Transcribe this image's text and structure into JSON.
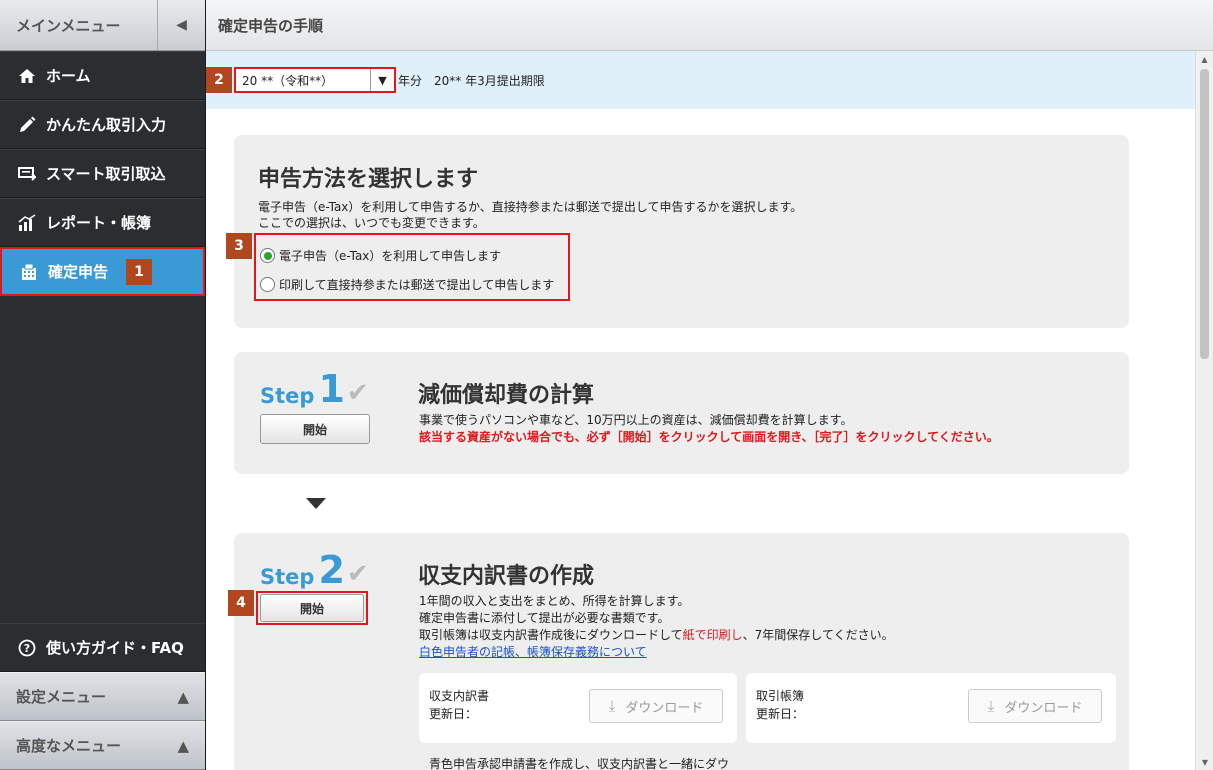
{
  "sidebar": {
    "title": "メインメニュー",
    "items": [
      {
        "label": "ホーム",
        "icon": "home-icon"
      },
      {
        "label": "かんたん取引入力",
        "icon": "pencil-icon"
      },
      {
        "label": "スマート取引取込",
        "icon": "import-icon"
      },
      {
        "label": "レポート・帳簿",
        "icon": "report-chart-icon"
      },
      {
        "label": "確定申告",
        "icon": "tax-return-icon",
        "active": true,
        "badge": "1"
      }
    ],
    "guide": "使い方ガイド・FAQ",
    "settings_menu": "設定メニュー",
    "advanced_menu": "高度なメニュー"
  },
  "header": {
    "title": "確定申告の手順"
  },
  "year_bar": {
    "badge": "2",
    "selected": "20 **（令和**）",
    "suffix": "年分",
    "deadline": "20** 年3月提出期限"
  },
  "method": {
    "title": "申告方法を選択します",
    "desc1": "電子申告（e-Tax）を利用して申告するか、直接持参または郵送で提出して申告するかを選択します。",
    "desc2": "ここでの選択は、いつでも変更できます。",
    "badge": "3",
    "option1": "電子申告（e-Tax）を利用して申告します",
    "option2": "印刷して直接持参または郵送で提出して申告します"
  },
  "step1": {
    "word": "Step",
    "num": "1",
    "button": "開始",
    "title": "減価償却費の計算",
    "desc": "事業で使うパソコンや車など、10万円以上の資産は、減価償却費を計算します。",
    "warning": "該当する資産がない場合でも、必ず［開始］をクリックして画面を開き、［完了］をクリックしてください。"
  },
  "step2": {
    "word": "Step",
    "num": "2",
    "button": "開始",
    "badge": "4",
    "title": "収支内訳書の作成",
    "line1": "1年間の収入と支出をまとめ、所得を計算します。",
    "line2": "確定申告書に添付して提出が必要な書類です。",
    "line3a": "取引帳簿は収支内訳書作成後にダウンロードして",
    "line3b": "紙で印刷し",
    "line3c": "、7年間保存してください。",
    "link": "白色申告者の記帳、帳簿保存義務について",
    "card1_title": "収支内訳書",
    "card1_date": "更新日：",
    "card2_title": "取引帳簿",
    "card2_date": "更新日：",
    "download": "ダウンロード",
    "extra": "青色申告承認申請書を作成し、収支内訳書と一緒にダウ"
  }
}
